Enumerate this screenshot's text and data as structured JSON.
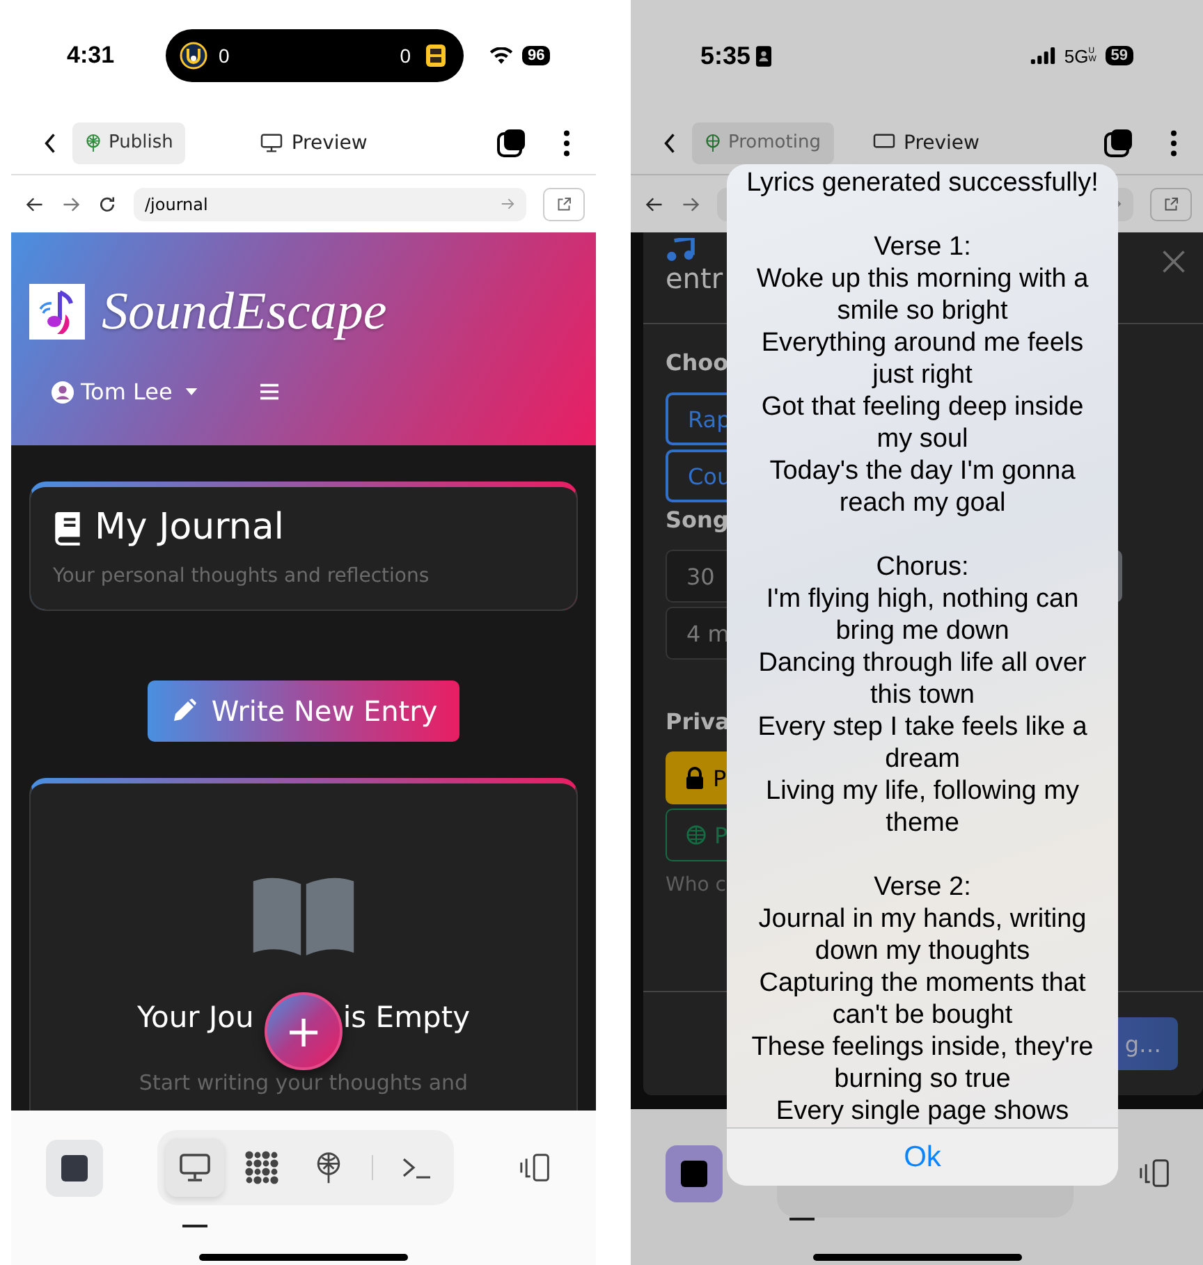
{
  "left": {
    "status_bar": {
      "time": "4:31",
      "away_score": "0",
      "home_score": "0",
      "battery": "96"
    },
    "toolbar": {
      "publish": "Publish",
      "preview": "Preview"
    },
    "url_bar": {
      "value": "/journal"
    },
    "site_header": {
      "brand": "SoundEscape",
      "user": "Tom Lee"
    },
    "journal_card": {
      "title": "My Journal",
      "subtitle": "Your personal thoughts and reflections"
    },
    "write_button": "Write New Entry",
    "empty_state": {
      "title_parts": [
        "Your Jou",
        "is Empty"
      ],
      "text": "Start writing your thoughts and"
    },
    "fab": "+",
    "dock": {
      "stop_active": false,
      "tools": [
        {
          "kind": "preview",
          "selected": true
        },
        {
          "kind": "cluster",
          "selected": false
        },
        {
          "kind": "publish",
          "selected": false
        },
        {
          "kind": "terminal",
          "selected": false
        }
      ]
    }
  },
  "right": {
    "status_bar": {
      "time": "5:35",
      "network": "5G",
      "network_sup": "UW",
      "battery": "59"
    },
    "toolbar": {
      "publish": "Promoting",
      "preview": "Preview"
    },
    "modal": {
      "title": "entr",
      "genre_label": "Choo",
      "genres": [
        "Rap",
        "Cou"
      ],
      "length_label": "Song",
      "lengths": [
        "30",
        "4 m"
      ],
      "privacy_label": "Priva",
      "privacy": [
        {
          "kind": "private",
          "text": "P"
        },
        {
          "kind": "public",
          "text": "P"
        }
      ],
      "privacy_hint": "Who c",
      "submit": "g…"
    },
    "alert": {
      "title": "Lyrics generated successfully!",
      "stanzas": [
        [
          "Verse 1:",
          "Woke up this morning with a smile so bright",
          "Everything around me feels just right",
          "Got that feeling deep inside my soul",
          "Today's the day I'm gonna reach my goal"
        ],
        [
          "Chorus:",
          "I'm flying high, nothing can bring me down",
          "Dancing through life all over this town",
          "Every step I take feels like a dream",
          "Living my life, following my theme"
        ],
        [
          "Verse 2:",
          "Journal in my hands, writing down my thoughts",
          "Capturing the moments that can't be bought",
          "These feelings inside, they're burning so true",
          "Every single page shows"
        ]
      ],
      "button": "Ok"
    },
    "dock": {
      "stop_active": true
    }
  }
}
